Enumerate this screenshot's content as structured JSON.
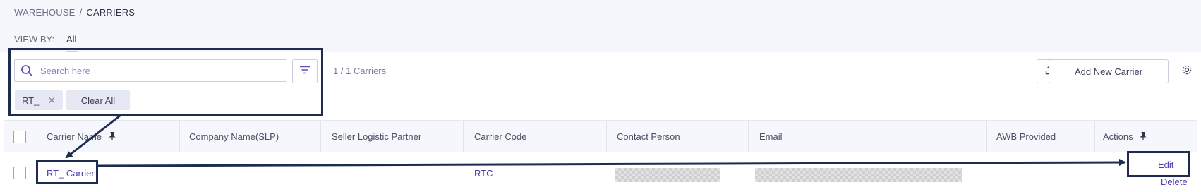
{
  "breadcrumb": {
    "parent": "WAREHOUSE",
    "separator": "/",
    "current": "CARRIERS"
  },
  "view_by": {
    "label": "VIEW BY:",
    "active_tab": "All"
  },
  "search": {
    "placeholder": "Search here",
    "value": ""
  },
  "result_count": "1 / 1 Carriers",
  "active_filter": {
    "chip_label": "RT_",
    "clear_all_label": "Clear All"
  },
  "toolbar": {
    "add_button_label": "Add New Carrier"
  },
  "table": {
    "columns": [
      "Carrier Name",
      "Company Name(SLP)",
      "Seller Logistic Partner",
      "Carrier Code",
      "Contact Person",
      "Email",
      "AWB Provided",
      "Actions"
    ],
    "rows": [
      {
        "carrier_name": "RT_ Carrier",
        "company_name": "-",
        "seller_logistic_partner": "-",
        "carrier_code": "RTC",
        "contact_person": "",
        "email": "",
        "awb_provided": "",
        "actions": {
          "edit": "Edit",
          "delete": "Delete"
        }
      }
    ]
  },
  "colors": {
    "accent": "#4b3fb4",
    "annotation": "#1e2d4f",
    "header_bg": "#f6f7fc"
  }
}
